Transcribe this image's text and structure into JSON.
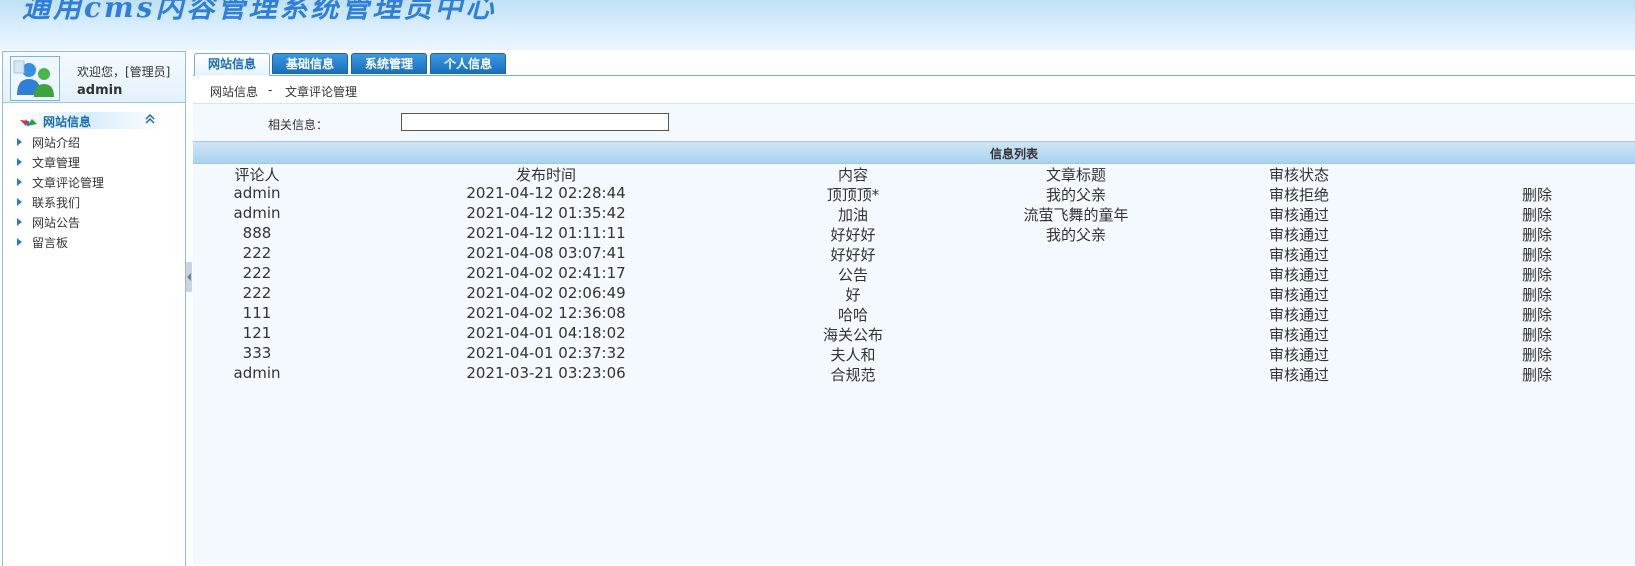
{
  "banner": {
    "title": "通用cms内容管理系统管理员中心"
  },
  "user": {
    "welcome": "欢迎您，[管理员]",
    "name": "admin"
  },
  "sidebar": {
    "header": "网站信息",
    "items": [
      {
        "label": "网站介绍"
      },
      {
        "label": "文章管理"
      },
      {
        "label": "文章评论管理"
      },
      {
        "label": "联系我们"
      },
      {
        "label": "网站公告"
      },
      {
        "label": "留言板"
      }
    ]
  },
  "tabs": [
    {
      "label": "网站信息",
      "active": true
    },
    {
      "label": "基础信息",
      "active": false
    },
    {
      "label": "系统管理",
      "active": false
    },
    {
      "label": "个人信息",
      "active": false
    }
  ],
  "breadcrumb": {
    "section": "网站信息",
    "separator": "-",
    "page": "文章评论管理"
  },
  "search": {
    "label": "相关信息：",
    "value": ""
  },
  "list": {
    "title": "信息列表",
    "headers": {
      "commenter": "评论人",
      "time": "发布时间",
      "content": "内容",
      "article": "文章标题",
      "status": "审核状态"
    },
    "rows": [
      {
        "commenter": "admin",
        "time": "2021-04-12 02:28:44",
        "content": "顶顶顶*",
        "article": "我的父亲",
        "status": "审核拒绝",
        "action": "删除"
      },
      {
        "commenter": "admin",
        "time": "2021-04-12 01:35:42",
        "content": "加油",
        "article": "流萤飞舞的童年",
        "status": "审核通过",
        "action": "删除"
      },
      {
        "commenter": "888",
        "time": "2021-04-12 01:11:11",
        "content": "好好好",
        "article": "我的父亲",
        "status": "审核通过",
        "action": "删除"
      },
      {
        "commenter": "222",
        "time": "2021-04-08 03:07:41",
        "content": "好好好",
        "article": "",
        "status": "审核通过",
        "action": "删除"
      },
      {
        "commenter": "222",
        "time": "2021-04-02 02:41:17",
        "content": "公告",
        "article": "",
        "status": "审核通过",
        "action": "删除"
      },
      {
        "commenter": "222",
        "time": "2021-04-02 02:06:49",
        "content": "好",
        "article": "",
        "status": "审核通过",
        "action": "删除"
      },
      {
        "commenter": "111",
        "time": "2021-04-02 12:36:08",
        "content": "哈哈",
        "article": "",
        "status": "审核通过",
        "action": "删除"
      },
      {
        "commenter": "121",
        "time": "2021-04-01 04:18:02",
        "content": "海关公布",
        "article": "",
        "status": "审核通过",
        "action": "删除"
      },
      {
        "commenter": "333",
        "time": "2021-04-01 02:37:32",
        "content": "夫人和",
        "article": "",
        "status": "审核通过",
        "action": "删除"
      },
      {
        "commenter": "admin",
        "time": "2021-03-21 03:23:06",
        "content": "合规范",
        "article": "",
        "status": "审核通过",
        "action": "删除"
      }
    ]
  },
  "colors": {
    "accent": "#1b6db3",
    "tab_blue": "#2a86d4",
    "list_bar": "#b7dbf3",
    "panel_bg": "#f3f9fe"
  },
  "icons": {
    "avatar": "users-avatar-icon",
    "header": "site-info-icon",
    "collapse": "double-chevron-up-icon",
    "item": "triangle-right-icon"
  }
}
